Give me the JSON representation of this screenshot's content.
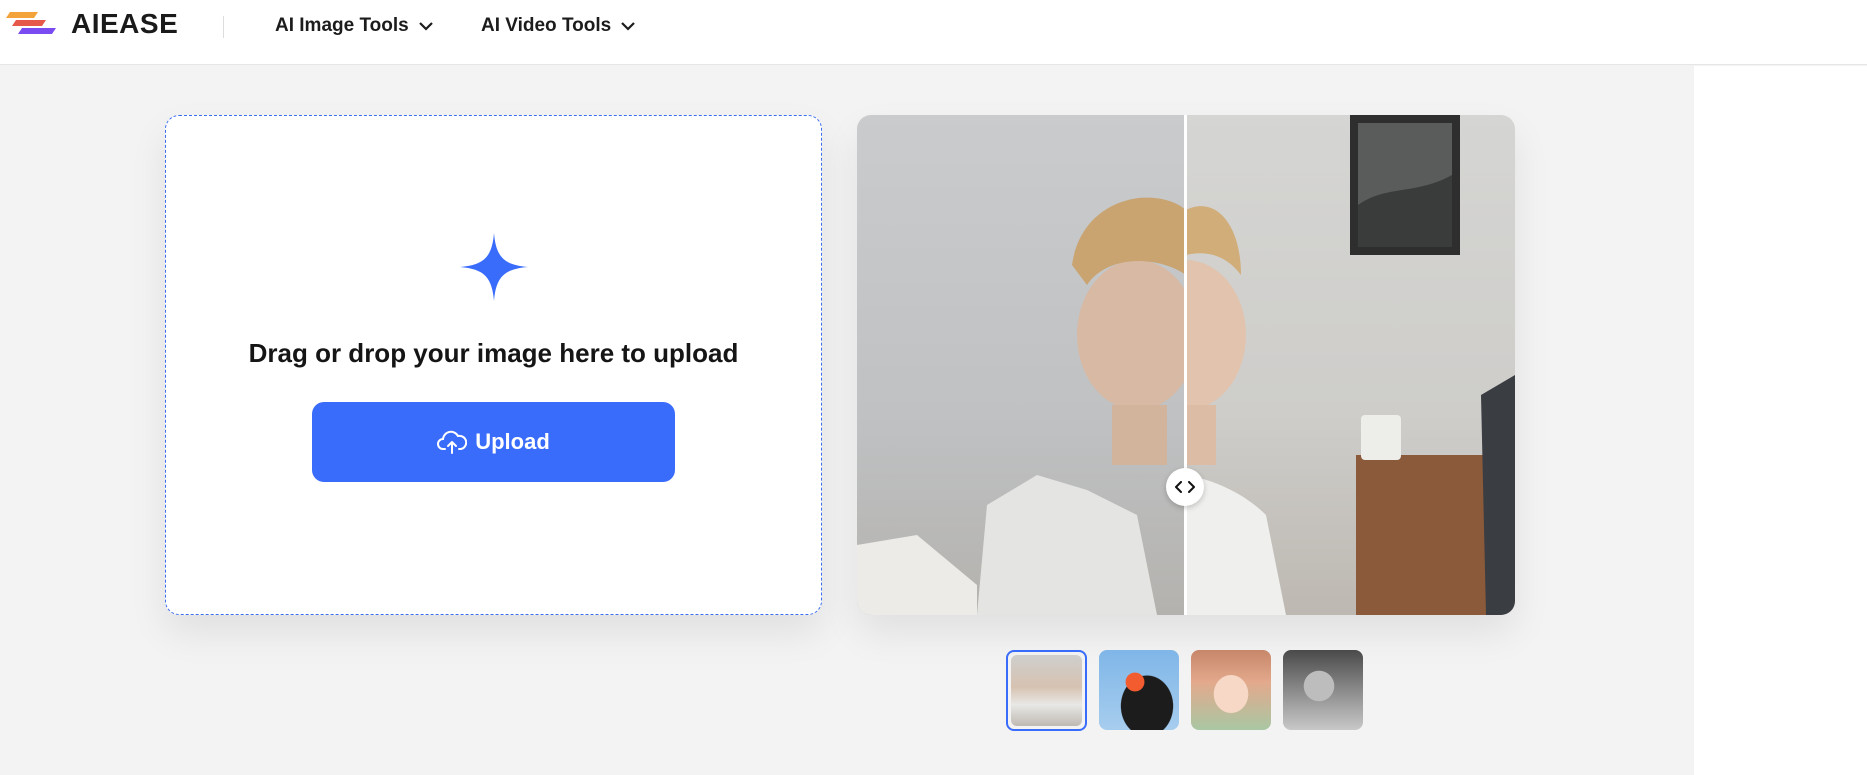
{
  "header": {
    "brand": "AIEASE",
    "nav": [
      {
        "label": "AI Image Tools"
      },
      {
        "label": "AI Video Tools"
      }
    ]
  },
  "upload": {
    "prompt": "Drag or drop your image here to upload",
    "button_label": "Upload"
  },
  "colors": {
    "accent": "#3a6cfb",
    "page_bg": "#f3f3f3"
  },
  "preview": {
    "divider_position": 0.5
  },
  "samples": {
    "selected_index": 0,
    "items": [
      {
        "icon": "portrait-man-thumbnail"
      },
      {
        "icon": "puffin-thumbnail"
      },
      {
        "icon": "anime-girl-thumbnail"
      },
      {
        "icon": "bw-woman-thumbnail"
      }
    ]
  }
}
